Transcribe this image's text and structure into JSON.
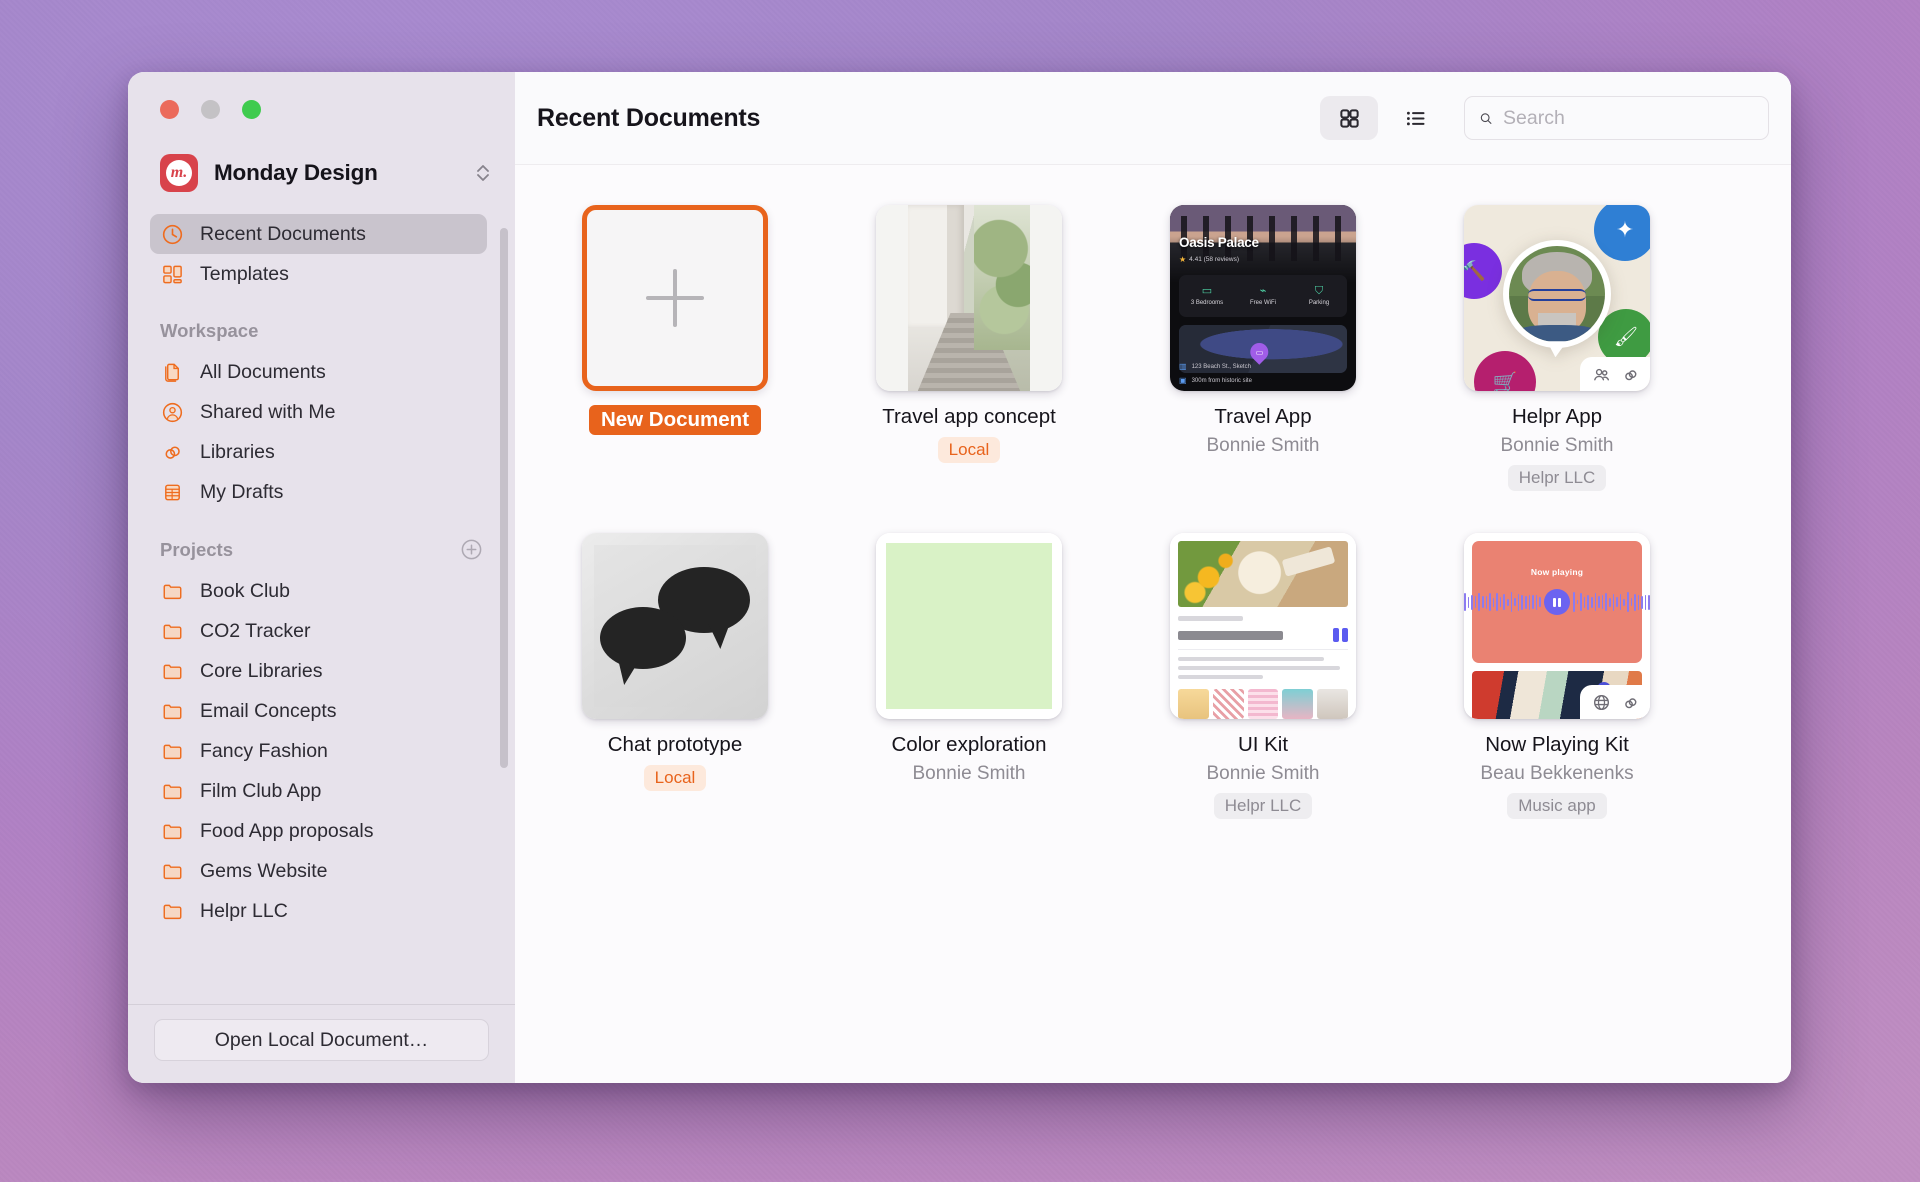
{
  "window": {
    "traffic_lights": [
      "close",
      "minimize",
      "zoom"
    ]
  },
  "sidebar": {
    "team": {
      "name": "Monday Design",
      "logo_glyph": "m.",
      "logo_color": "#d8434b"
    },
    "top_items": [
      {
        "label": "Recent Documents",
        "icon": "clock-icon",
        "active": true
      },
      {
        "label": "Templates",
        "icon": "templates-icon",
        "active": false
      }
    ],
    "workspace": {
      "title": "Workspace",
      "items": [
        {
          "label": "All Documents",
          "icon": "documents-icon"
        },
        {
          "label": "Shared with Me",
          "icon": "person-circle-icon"
        },
        {
          "label": "Libraries",
          "icon": "libraries-icon"
        },
        {
          "label": "My Drafts",
          "icon": "drafts-icon"
        }
      ]
    },
    "projects": {
      "title": "Projects",
      "add_label": "+",
      "items": [
        {
          "label": "Book Club"
        },
        {
          "label": "CO2 Tracker"
        },
        {
          "label": "Core Libraries"
        },
        {
          "label": "Email Concepts"
        },
        {
          "label": "Fancy Fashion"
        },
        {
          "label": "Film Club App"
        },
        {
          "label": "Food App proposals"
        },
        {
          "label": "Gems Website"
        },
        {
          "label": "Helpr LLC"
        }
      ]
    },
    "footer_button": "Open Local Document…"
  },
  "header": {
    "title": "Recent Documents",
    "view_grid": "grid-view",
    "view_list": "list-view",
    "active_view": "grid"
  },
  "search": {
    "placeholder": "Search",
    "value": ""
  },
  "documents": [
    {
      "title": "New Document",
      "subtitle": "",
      "badge": "",
      "badge_style": "",
      "selected": true,
      "art": "new"
    },
    {
      "title": "Travel app concept",
      "subtitle": "",
      "badge": "Local",
      "badge_style": "local",
      "selected": false,
      "art": "street"
    },
    {
      "title": "Travel App",
      "subtitle": "Bonnie Smith",
      "badge": "",
      "badge_style": "",
      "selected": false,
      "art": "travel",
      "art_text": {
        "hotel": "Oasis Palace",
        "rating": "4.41 (58 reviews)",
        "amenities": [
          "3 Bedrooms",
          "Free WiFi",
          "Parking"
        ],
        "address": "123 Beach St., Sketch",
        "distance": "300m from historic site"
      }
    },
    {
      "title": "Helpr App",
      "subtitle": "Bonnie Smith",
      "badge": "Helpr LLC",
      "badge_style": "gray",
      "selected": false,
      "art": "helpr"
    },
    {
      "title": "Chat prototype",
      "subtitle": "",
      "badge": "Local",
      "badge_style": "local",
      "selected": false,
      "art": "chat"
    },
    {
      "title": "Color exploration",
      "subtitle": "Bonnie Smith",
      "badge": "",
      "badge_style": "",
      "selected": false,
      "art": "color"
    },
    {
      "title": "UI Kit",
      "subtitle": "Bonnie Smith",
      "badge": "Helpr LLC",
      "badge_style": "gray",
      "selected": false,
      "art": "kit"
    },
    {
      "title": "Now Playing Kit",
      "subtitle": "Beau Bekkenenks",
      "badge": "Music app",
      "badge_style": "gray",
      "selected": false,
      "art": "now",
      "art_text": {
        "label": "Now playing"
      }
    }
  ],
  "colors": {
    "accent": "#e8631c",
    "sidebar_bg": "#e7e2eb",
    "badge_local_bg": "#fde9dc",
    "badge_gray_bg": "#eeedf0"
  }
}
